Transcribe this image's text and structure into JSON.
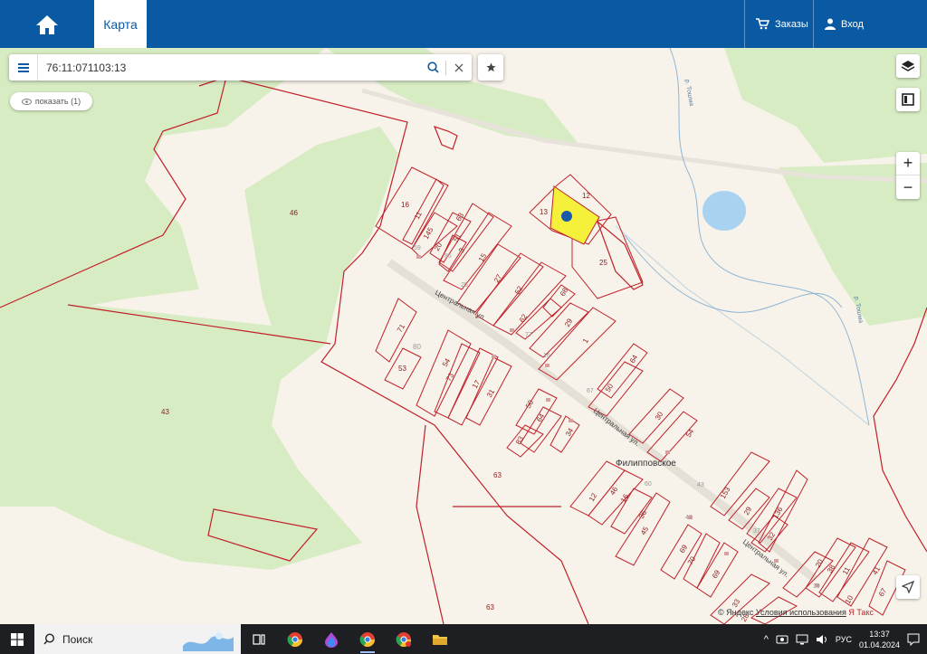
{
  "header": {
    "home_icon": "home-icon",
    "tab_map": "Карта",
    "orders_label": "Заказы",
    "login_label": "Вход"
  },
  "search": {
    "value": "76:11:071103:13"
  },
  "show_button": "показать (1)",
  "map": {
    "parcel_labels": [
      "16",
      "11",
      "63",
      "145",
      "20",
      "51",
      "3",
      "15",
      "27",
      "52",
      "62",
      "68",
      "29",
      "1",
      "13",
      "12",
      "25",
      "71",
      "80",
      "53",
      "54",
      "73",
      "17",
      "31",
      "50",
      "64",
      "34",
      "83",
      "30",
      "54",
      "64",
      "50",
      "12",
      "46",
      "16",
      "36",
      "45",
      "69",
      "70",
      "69",
      "153",
      "29",
      "136",
      "32",
      "33",
      "28",
      "20",
      "38",
      "11",
      "41",
      "10",
      "67",
      "46",
      "43",
      "63",
      "63"
    ],
    "street_labels": [
      "Центральная ул.",
      "Центральная ул.",
      "Центральная ул."
    ],
    "river_labels": [
      "р. Тошма",
      "р. Тошма"
    ],
    "village_label": "Филипповское",
    "house_numbers": [
      "59",
      "85",
      "77",
      "67",
      "60",
      "43",
      "42",
      "37",
      "19",
      "25",
      "16"
    ],
    "colors": {
      "forest": "#d8ecc4",
      "land": "#f7f3ea",
      "boundary": "#c0202a",
      "selected": "#f5f03a",
      "water": "#a9d2f0"
    }
  },
  "controls": {
    "layers_icon": "layers-icon",
    "frame_icon": "frame-icon",
    "zoom_in": "+",
    "zoom_out": "−",
    "locate_icon": "navigation-arrow-icon"
  },
  "attribution": {
    "text": "© Яндекс",
    "link": "Условия использования",
    "trail": "Я Такс"
  },
  "taskbar": {
    "search_label": "Поиск",
    "lang": "РУС",
    "time": "13:37",
    "date": "01.04.2024"
  }
}
